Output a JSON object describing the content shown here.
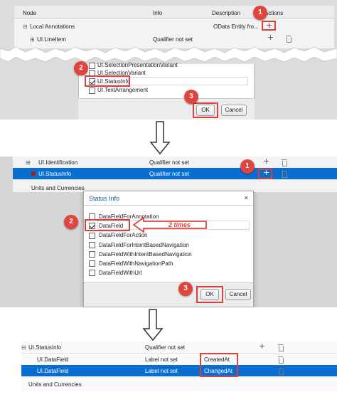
{
  "panel1": {
    "columns": {
      "node": "Node",
      "info": "Info",
      "description": "Description",
      "actions": "Actions"
    },
    "rows": [
      {
        "node": "Local Annotations",
        "info": "",
        "description": "OData Entity fro..."
      },
      {
        "node": "UI.LineItem",
        "info": "Qualifier not set",
        "description": ""
      }
    ],
    "list_items": [
      "UI.SelectionPresentationVariant",
      "UI.SelectionVariant",
      "UI.StatusInfo",
      "UI.TextArrangement"
    ],
    "ok_label": "OK",
    "cancel_label": "Cancel",
    "badges": [
      "1",
      "2",
      "3"
    ]
  },
  "panel2": {
    "rows": [
      {
        "node": "UI.Identification",
        "info": "Qualifier not set"
      },
      {
        "node": "UI.StatusInfo",
        "info": "Qualifier not set"
      },
      {
        "node": "Units and Currencies",
        "info": ""
      }
    ],
    "dialog_title": "Status Info",
    "close_glyph": "✕",
    "list_items": [
      "DataFieldForAnnotation",
      "DataField",
      "DataFieldForAction",
      "DataFieldForIntentBasedNavigation",
      "DataFieldWithIntentBasedNavigation",
      "DataFieldWithNavigationPath",
      "DataFieldWithUrl"
    ],
    "callout": "2 times",
    "ok_label": "OK",
    "cancel_label": "Cancel",
    "badges": [
      "1",
      "2",
      "3"
    ]
  },
  "panel3": {
    "rows": [
      {
        "node": "UI.StatusInfo",
        "info": "Qualifier not set",
        "field": ""
      },
      {
        "node": "UI.DataField",
        "info": "Label not set",
        "field": "CreatedAt"
      },
      {
        "node": "UI.DataField",
        "info": "Label not set",
        "field": "ChangedAt"
      },
      {
        "node": "Units and Currencies",
        "info": "",
        "field": ""
      }
    ]
  },
  "colors": {
    "badge": "#e0443f",
    "highlight": "#0a6ed1",
    "callout": "#e0443f"
  }
}
